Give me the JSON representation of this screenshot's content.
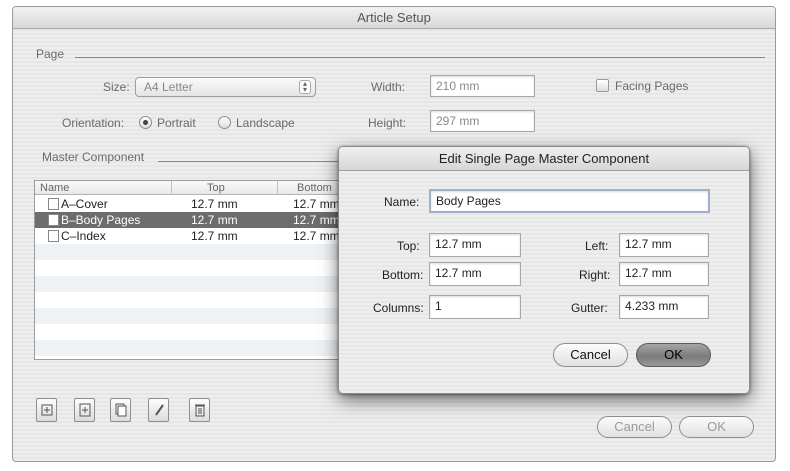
{
  "window": {
    "title": "Article Setup"
  },
  "page": {
    "section_label": "Page",
    "size_label": "Size:",
    "size_value": "A4 Letter",
    "orientation_label": "Orientation:",
    "portrait_label": "Portrait",
    "landscape_label": "Landscape",
    "width_label": "Width:",
    "width_value": "210 mm",
    "height_label": "Height:",
    "height_value": "297 mm",
    "facing_pages_label": "Facing Pages",
    "orientation_selected": "Portrait",
    "facing_pages_checked": false
  },
  "master": {
    "section_label": "Master Component",
    "columns": [
      "Name",
      "Top",
      "Bottom"
    ],
    "rows": [
      {
        "name": "A–Cover",
        "top": "12.7 mm",
        "bottom": "12.7 mm",
        "selected": false
      },
      {
        "name": "B–Body Pages",
        "top": "12.7 mm",
        "bottom": "12.7 mm",
        "selected": true
      },
      {
        "name": "C–Index",
        "top": "12.7 mm",
        "bottom": "12.7 mm",
        "selected": false
      }
    ]
  },
  "toolbar": {
    "icons": [
      "new-master-icon",
      "add-page-icon",
      "duplicate-icon",
      "edit-pencil-icon",
      "trash-icon"
    ]
  },
  "buttons": {
    "cancel": "Cancel",
    "ok": "OK"
  },
  "sheet": {
    "title": "Edit Single Page Master Component",
    "name_label": "Name:",
    "name_value": "Body Pages",
    "top_label": "Top:",
    "top_value": "12.7 mm",
    "left_label": "Left:",
    "left_value": "12.7 mm",
    "bottom_label": "Bottom:",
    "bottom_value": "12.7 mm",
    "right_label": "Right:",
    "right_value": "12.7 mm",
    "columns_label": "Columns:",
    "columns_value": "1",
    "gutter_label": "Gutter:",
    "gutter_value": "4.233 mm",
    "cancel": "Cancel",
    "ok": "OK"
  }
}
